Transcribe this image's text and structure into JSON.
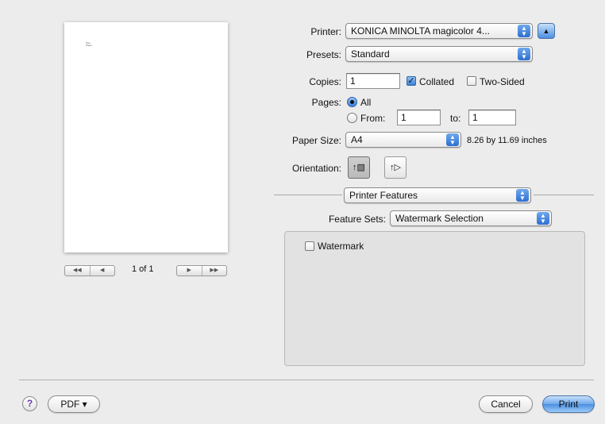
{
  "preview": {
    "page_label": "1 of 1",
    "tiny_text": "Test\nPaper"
  },
  "printer": {
    "label": "Printer:",
    "value": "KONICA MINOLTA magicolor 4..."
  },
  "presets": {
    "label": "Presets:",
    "value": "Standard"
  },
  "copies": {
    "label": "Copies:",
    "value": "1",
    "collated_label": "Collated",
    "collated_checked": true,
    "two_sided_label": "Two-Sided",
    "two_sided_checked": false
  },
  "pages": {
    "label": "Pages:",
    "all_label": "All",
    "from_label": "From:",
    "from_value": "1",
    "to_label": "to:",
    "to_value": "1",
    "selected": "All"
  },
  "paper_size": {
    "label": "Paper Size:",
    "value": "A4",
    "dimensions": "8.26 by 11.69 inches"
  },
  "orientation": {
    "label": "Orientation:",
    "selected": "portrait"
  },
  "section_popup": {
    "value": "Printer Features"
  },
  "feature_sets": {
    "label": "Feature Sets:",
    "value": "Watermark Selection"
  },
  "watermark": {
    "label": "Watermark",
    "checked": false
  },
  "footer": {
    "help_label": "?",
    "pdf_label": "PDF ▾",
    "cancel_label": "Cancel",
    "print_label": "Print"
  },
  "colors": {
    "accent": "#3c80d8",
    "background": "#ececec"
  }
}
